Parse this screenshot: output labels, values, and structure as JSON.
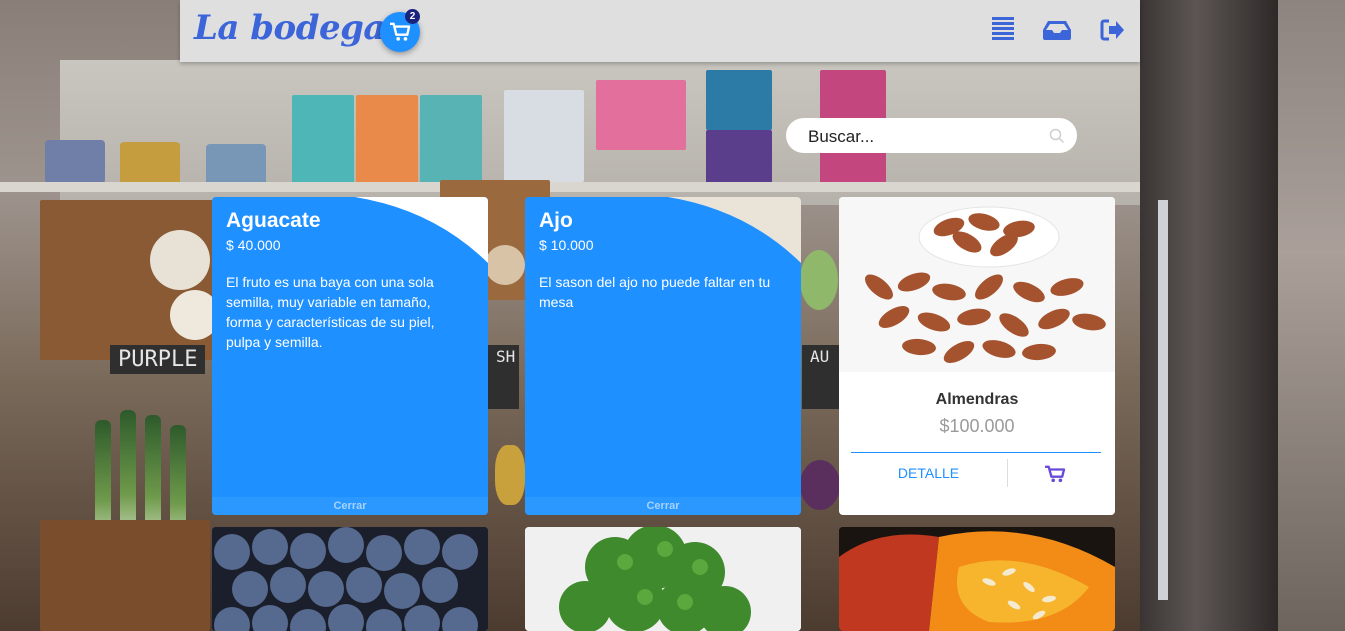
{
  "header": {
    "brand": "La bodega",
    "cart_count": "2",
    "icons": [
      "menu-icon",
      "inbox-icon",
      "logout-icon"
    ]
  },
  "search": {
    "placeholder": "Buscar..."
  },
  "colors": {
    "primary": "#1e90ff",
    "brand": "#3b65d9",
    "badge": "#1a237e",
    "header_bg": "#dfdfdf"
  },
  "products": [
    {
      "name": "Aguacate",
      "price": "$ 40.000",
      "description": "El fruto es una baya con una sola semilla, muy variable en tamaño, forma y características de su piel, pulpa y semilla.",
      "close_label": "Cerrar"
    },
    {
      "name": "Ajo",
      "price": "$ 10.000",
      "description": "El sason del ajo no puede faltar en tu mesa",
      "close_label": "Cerrar"
    },
    {
      "name": "Almendras",
      "price": "$100.000",
      "detail_label": "DETALLE",
      "image": "almonds-image"
    }
  ],
  "more_products": [
    {
      "image": "blueberries-image"
    },
    {
      "image": "broccoli-image"
    },
    {
      "image": "pumpkin-image"
    }
  ]
}
